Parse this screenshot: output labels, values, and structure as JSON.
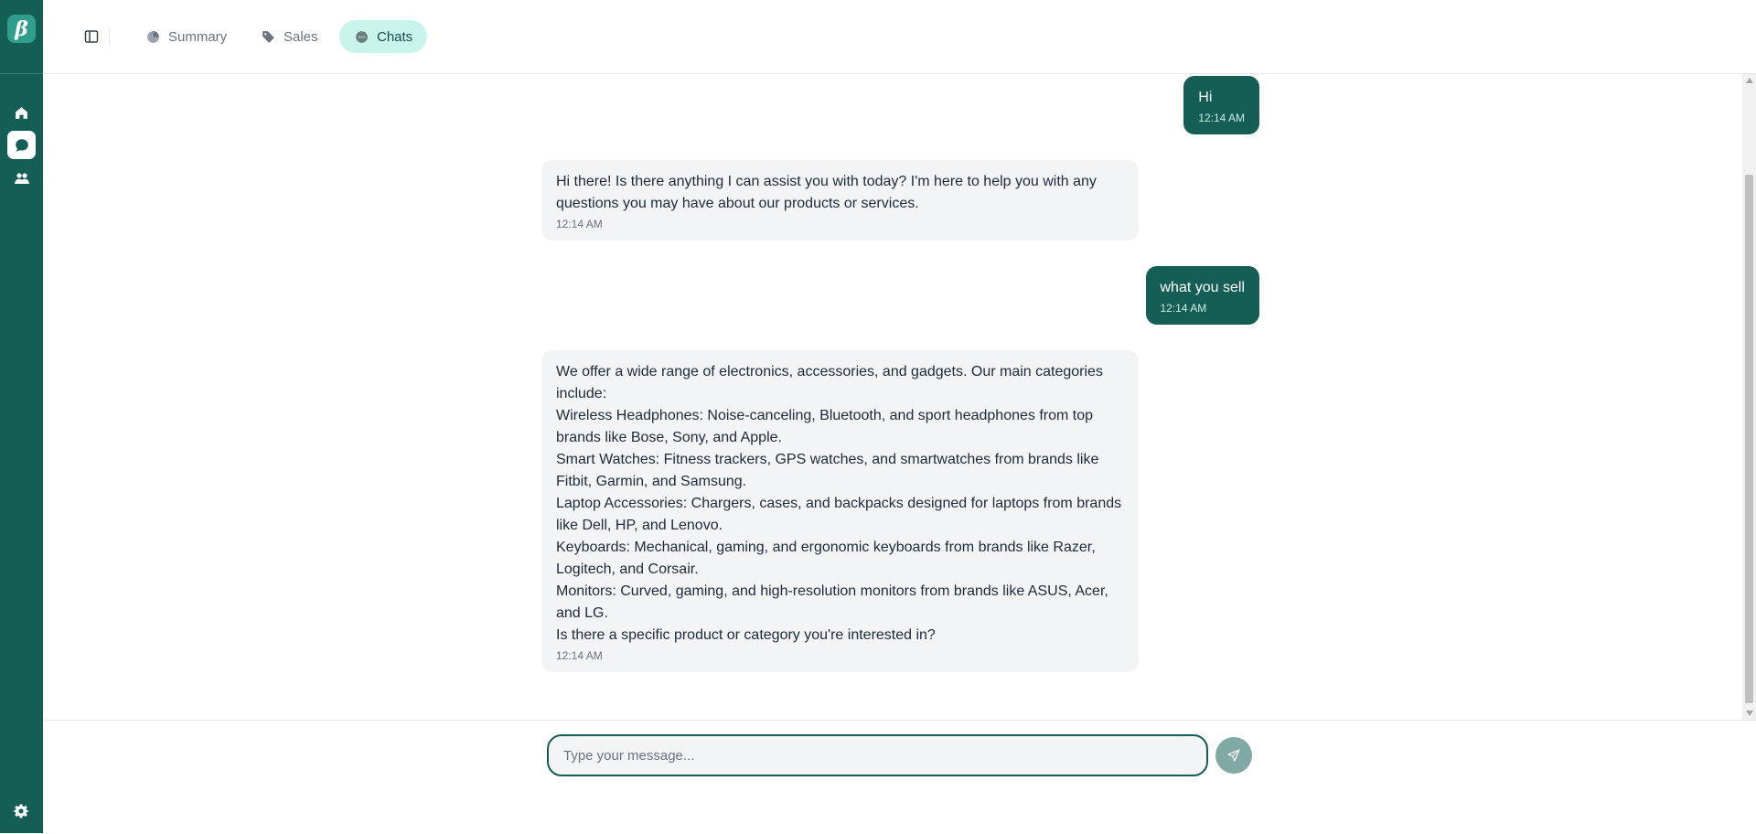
{
  "app": {
    "logo_letter": "β"
  },
  "rail": {
    "items": [
      {
        "name": "home",
        "icon": "home-icon",
        "active": false
      },
      {
        "name": "chats",
        "icon": "chat-bubble-icon",
        "active": true
      },
      {
        "name": "users",
        "icon": "users-icon",
        "active": false
      }
    ],
    "settings_icon": "gear-icon"
  },
  "header": {
    "tabs": [
      {
        "label": "Summary",
        "icon": "pie-chart-icon",
        "active": false
      },
      {
        "label": "Sales",
        "icon": "tag-icon",
        "active": false
      },
      {
        "label": "Chats",
        "icon": "chat-bubble-icon",
        "active": true
      }
    ]
  },
  "messages": [
    {
      "role": "user",
      "lines": [
        "Hi"
      ],
      "time": "12:14 AM"
    },
    {
      "role": "assistant",
      "lines": [
        "Hi there! Is there anything I can assist you with today? I'm here to help you with any questions you may have about our products or services."
      ],
      "time": "12:14 AM"
    },
    {
      "role": "user",
      "lines": [
        "what you sell"
      ],
      "time": "12:14 AM"
    },
    {
      "role": "assistant",
      "lines": [
        "We offer a wide range of electronics, accessories, and gadgets. Our main categories include:",
        "Wireless Headphones: Noise-canceling, Bluetooth, and sport headphones from top brands like Bose, Sony, and Apple.",
        "Smart Watches: Fitness trackers, GPS watches, and smartwatches from brands like Fitbit, Garmin, and Samsung.",
        "Laptop Accessories: Chargers, cases, and backpacks designed for laptops from brands like Dell, HP, and Lenovo.",
        "Keyboards: Mechanical, gaming, and ergonomic keyboards from brands like Razer, Logitech, and Corsair.",
        "Monitors: Curved, gaming, and high-resolution monitors from brands like ASUS, Acer, and LG.",
        "Is there a specific product or category you're interested in?"
      ],
      "time": "12:14 AM"
    }
  ],
  "composer": {
    "placeholder": "Type your message...",
    "value": ""
  },
  "colors": {
    "brand": "#155e55",
    "active_tab_bg": "#c9f4ec",
    "bot_bubble": "#f3f4f6",
    "send_disabled": "#7fa9a2"
  }
}
